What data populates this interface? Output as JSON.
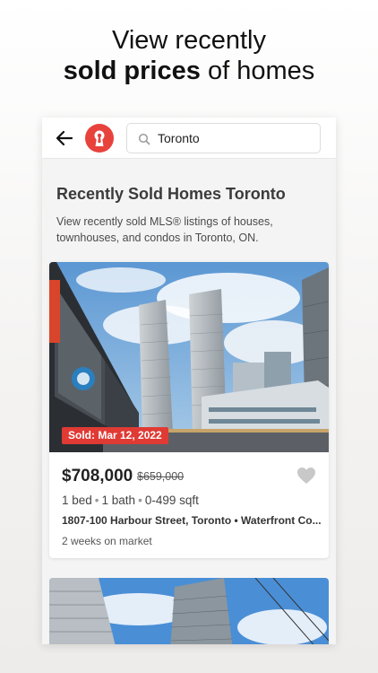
{
  "promo": {
    "line1": "View recently",
    "line2_bold": "sold prices",
    "line2_rest": " of homes"
  },
  "appbar": {
    "back_icon": "arrow-left-icon",
    "logo_icon": "keyhole-logo-icon",
    "search_icon": "search-icon",
    "search_value": "Toronto",
    "accent": "#e8423c"
  },
  "page": {
    "title": "Recently Sold Homes Toronto",
    "subtitle": "View recently sold MLS® listings of houses, townhouses, and condos in Toronto, ON."
  },
  "listings": [
    {
      "sold_label": "Sold: Mar 12, 2022",
      "price": "$708,000",
      "original_price": "$659,000",
      "beds": "1 bed",
      "baths": "1 bath",
      "sqft": "0-499 sqft",
      "address": "1807-100 Harbour Street, Toronto • Waterfront Co...",
      "days_on_market": "2 weeks on market",
      "favorite_icon": "heart-icon"
    }
  ],
  "colors": {
    "sold_badge": "#e03a34",
    "sky": "#6fa6d8",
    "heart": "#c8c8c8"
  }
}
